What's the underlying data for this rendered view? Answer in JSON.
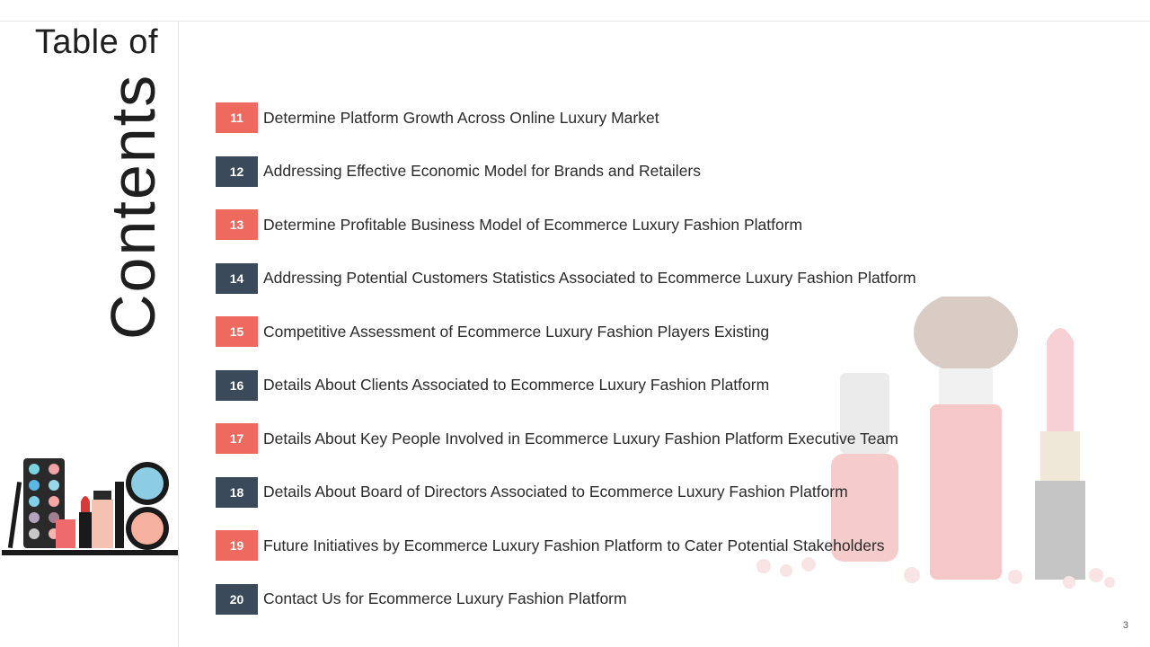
{
  "title": {
    "line1": "Table of",
    "line2": "Contents"
  },
  "colors": {
    "accent_red": "#ef6a5e",
    "accent_dark": "#3a4a5b"
  },
  "toc": [
    {
      "num": "11",
      "text": "Determine Platform Growth Across Online Luxury Market",
      "color": "red"
    },
    {
      "num": "12",
      "text": "Addressing Effective Economic Model for Brands and Retailers",
      "color": "dark"
    },
    {
      "num": "13",
      "text": "Determine Profitable Business Model of Ecommerce Luxury Fashion Platform",
      "color": "red"
    },
    {
      "num": "14",
      "text": "Addressing Potential Customers Statistics Associated to Ecommerce Luxury Fashion Platform",
      "color": "dark"
    },
    {
      "num": "15",
      "text": "Competitive Assessment of Ecommerce Luxury Fashion Players Existing",
      "color": "red"
    },
    {
      "num": "16",
      "text": "Details About Clients Associated to Ecommerce Luxury Fashion Platform",
      "color": "dark"
    },
    {
      "num": "17",
      "text": "Details About Key People Involved in Ecommerce Luxury Fashion Platform Executive Team",
      "color": "red"
    },
    {
      "num": "18",
      "text": "Details About Board of Directors Associated to Ecommerce Luxury Fashion Platform",
      "color": "dark"
    },
    {
      "num": "19",
      "text": "Future Initiatives by Ecommerce Luxury Fashion Platform to Cater Potential Stakeholders",
      "color": "red"
    },
    {
      "num": "20",
      "text": "Contact Us for Ecommerce Luxury Fashion Platform",
      "color": "dark"
    }
  ],
  "page_number": "3"
}
